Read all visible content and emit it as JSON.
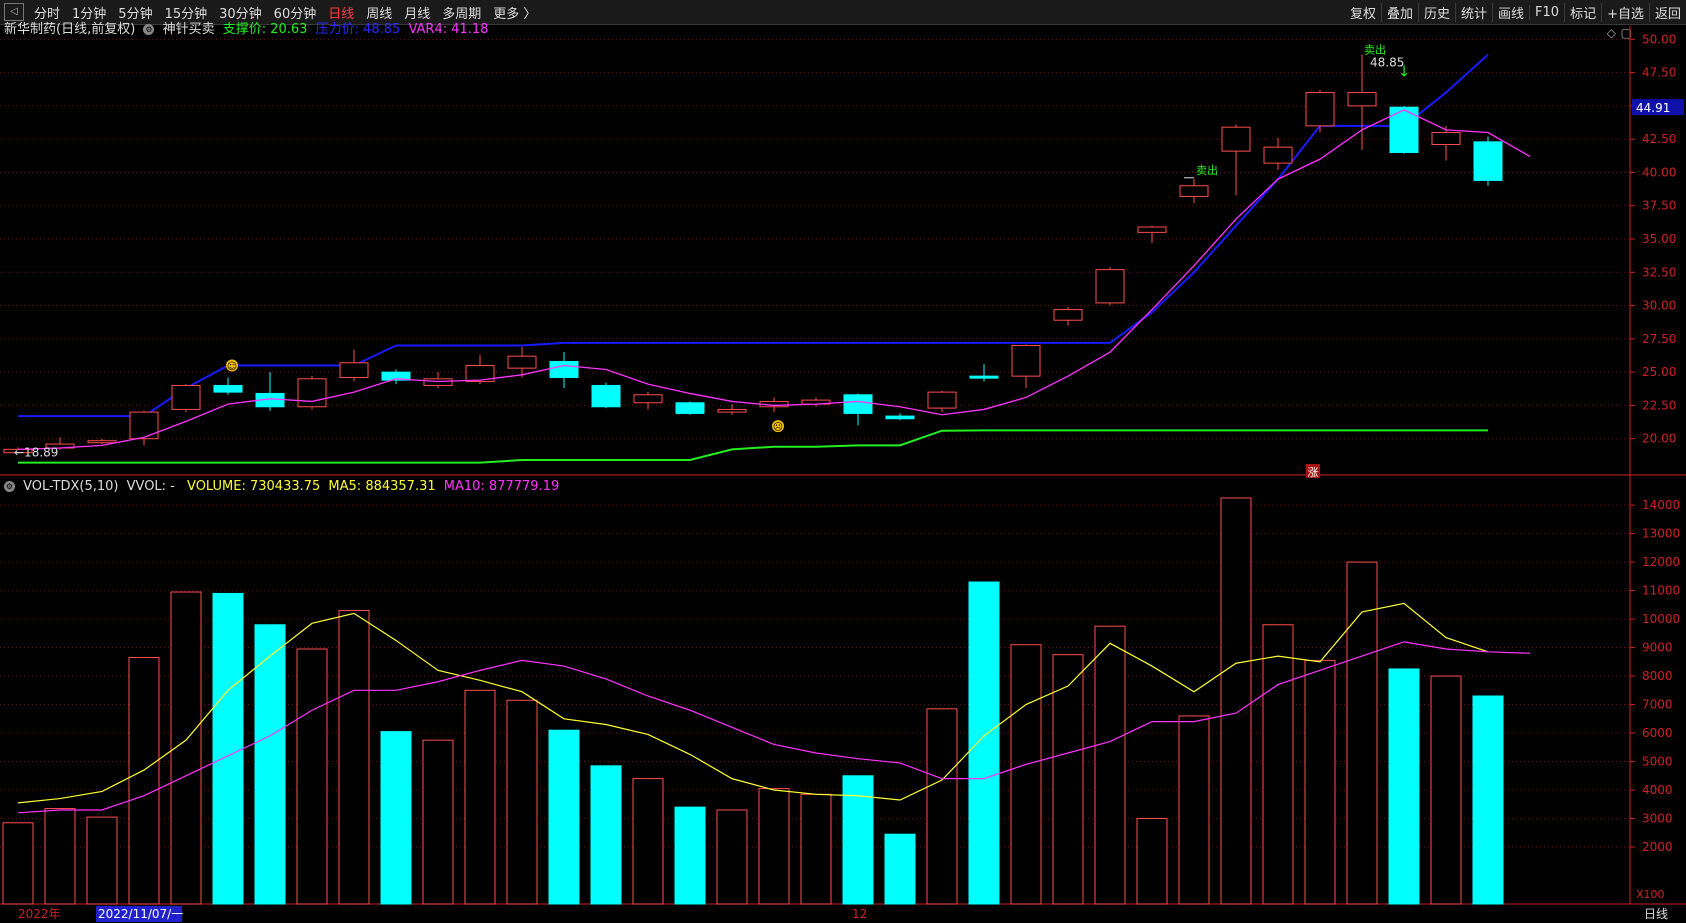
{
  "toolbar": {
    "collapse_label": "◁",
    "periods": [
      "分时",
      "1分钟",
      "5分钟",
      "15分钟",
      "30分钟",
      "60分钟",
      "日线",
      "周线",
      "月线",
      "多周期",
      "更多 〉"
    ],
    "active_period_index": 6,
    "tools": [
      "复权",
      "叠加",
      "历史",
      "统计",
      "画线",
      "F10",
      "标记",
      "+自选",
      "返回"
    ]
  },
  "main_info": {
    "stock_name": "新华制药(日线,前复权)",
    "indicator_name": "神针买卖",
    "support_label": "支撑价: 20.63",
    "pressure_label": "压力价: 48.85",
    "var4_label": "VAR4: 41.18"
  },
  "vol_info": {
    "name": "VOL-TDX(5,10)",
    "vvol": "VVOL: -",
    "volume_label": "VOLUME: 730433.75",
    "ma5_label": "MA5: 884357.31",
    "ma10_label": "MA10: 877779.19"
  },
  "annotations": {
    "low_label": "←18.89",
    "high_label": "48.85",
    "sell_label_1": "卖出",
    "sell_label_2": "卖出",
    "current_price": "44.91",
    "zhang_mark": "涨",
    "vol_unit": "X100",
    "bottom_right": "日线",
    "x_year": "2022年",
    "x_cursor_date": "2022/11/07/一",
    "x_month": "12"
  },
  "colors": {
    "up": "#ff4d4d",
    "down": "#00ffff",
    "ma": "#ff33ff",
    "ma5_vol": "#ffff33",
    "pressure": "#1a1aff",
    "support": "#22ee22",
    "axis": "#cc2222",
    "grid": "#661111"
  },
  "chart_data": [
    {
      "type": "candlestick",
      "price_axis": {
        "ylim": [
          17.5,
          51.0
        ],
        "ticks": [
          "20.00",
          "22.50",
          "25.00",
          "27.50",
          "30.00",
          "32.50",
          "35.00",
          "37.50",
          "40.00",
          "42.50",
          "45.00",
          "47.50",
          "50.00"
        ]
      },
      "candles": [
        {
          "open": 18.95,
          "close": 19.2,
          "high": 19.35,
          "low": 18.89
        },
        {
          "open": 19.3,
          "close": 19.6,
          "high": 20.1,
          "low": 19.15
        },
        {
          "open": 19.7,
          "close": 19.85,
          "high": 20.0,
          "low": 19.6
        },
        {
          "open": 20.0,
          "close": 22.0,
          "high": 22.1,
          "low": 19.5
        },
        {
          "open": 22.2,
          "close": 24.0,
          "high": 24.1,
          "low": 22.0
        },
        {
          "open": 24.0,
          "close": 23.5,
          "high": 24.6,
          "low": 23.3
        },
        {
          "open": 23.4,
          "close": 22.4,
          "high": 25.0,
          "low": 22.1
        },
        {
          "open": 22.4,
          "close": 24.5,
          "high": 24.7,
          "low": 22.2
        },
        {
          "open": 24.6,
          "close": 25.7,
          "high": 26.7,
          "low": 24.3
        },
        {
          "open": 25.0,
          "close": 24.4,
          "high": 25.2,
          "low": 24.1
        },
        {
          "open": 24.0,
          "close": 24.5,
          "high": 25.0,
          "low": 23.8
        },
        {
          "open": 24.3,
          "close": 25.5,
          "high": 26.3,
          "low": 24.1
        },
        {
          "open": 25.3,
          "close": 26.2,
          "high": 26.9,
          "low": 24.6
        },
        {
          "open": 25.8,
          "close": 24.6,
          "high": 26.5,
          "low": 23.8
        },
        {
          "open": 24.0,
          "close": 22.4,
          "high": 24.2,
          "low": 22.3
        },
        {
          "open": 22.7,
          "close": 23.3,
          "high": 23.5,
          "low": 22.2
        },
        {
          "open": 22.7,
          "close": 21.9,
          "high": 22.8,
          "low": 21.8
        },
        {
          "open": 22.0,
          "close": 22.2,
          "high": 22.6,
          "low": 21.8
        },
        {
          "open": 22.4,
          "close": 22.8,
          "high": 23.1,
          "low": 22.0
        },
        {
          "open": 22.6,
          "close": 22.9,
          "high": 23.1,
          "low": 22.4
        },
        {
          "open": 23.3,
          "close": 21.9,
          "high": 23.4,
          "low": 21.0
        },
        {
          "open": 21.7,
          "close": 21.5,
          "high": 21.9,
          "low": 21.4
        },
        {
          "open": 22.3,
          "close": 23.5,
          "high": 23.6,
          "low": 22.0
        },
        {
          "open": 24.7,
          "close": 24.6,
          "high": 25.6,
          "low": 24.3
        },
        {
          "open": 24.7,
          "close": 27.0,
          "high": 27.1,
          "low": 23.8
        },
        {
          "open": 28.9,
          "close": 29.7,
          "high": 29.9,
          "low": 28.5
        },
        {
          "open": 30.2,
          "close": 32.7,
          "high": 32.9,
          "low": 30.0
        },
        {
          "open": 35.5,
          "close": 35.9,
          "high": 36.0,
          "low": 34.7
        },
        {
          "open": 38.2,
          "close": 39.0,
          "high": 39.5,
          "low": 37.7
        },
        {
          "open": 41.6,
          "close": 43.4,
          "high": 43.6,
          "low": 38.3
        },
        {
          "open": 40.7,
          "close": 41.9,
          "high": 42.6,
          "low": 40.2
        },
        {
          "open": 43.5,
          "close": 46.0,
          "high": 46.2,
          "low": 43.0
        },
        {
          "open": 45.0,
          "close": 46.0,
          "high": 48.85,
          "low": 41.7
        },
        {
          "open": 44.9,
          "close": 41.5,
          "high": 45.0,
          "low": 41.4
        },
        {
          "open": 42.1,
          "close": 43.0,
          "high": 43.5,
          "low": 40.9
        },
        {
          "open": 42.3,
          "close": 39.4,
          "high": 42.7,
          "low": 39.0
        }
      ],
      "ma": [
        19.2,
        19.3,
        19.5,
        20.1,
        21.3,
        22.6,
        23.0,
        22.8,
        23.5,
        24.5,
        24.3,
        24.4,
        24.8,
        25.5,
        25.2,
        24.1,
        23.4,
        22.8,
        22.5,
        22.6,
        22.8,
        22.4,
        21.8,
        22.2,
        23.1,
        24.7,
        26.5,
        29.7,
        33.0,
        36.5,
        39.5,
        41.0,
        43.2,
        44.7,
        43.2,
        43.0,
        41.2
      ],
      "pressure": [
        21.7,
        21.7,
        21.7,
        21.7,
        23.8,
        25.5,
        25.5,
        25.5,
        25.5,
        27.0,
        27.0,
        27.0,
        27.0,
        27.2,
        27.2,
        27.2,
        27.2,
        27.2,
        27.2,
        27.2,
        27.2,
        27.2,
        27.2,
        27.2,
        27.2,
        27.2,
        27.2,
        29.5,
        32.5,
        36.0,
        39.5,
        43.5,
        43.5,
        43.5,
        46.0,
        48.85,
        48.85,
        48.85
      ],
      "support": [
        18.2,
        18.2,
        18.2,
        18.2,
        18.2,
        18.2,
        18.2,
        18.2,
        18.2,
        18.2,
        18.2,
        18.2,
        18.4,
        18.4,
        18.4,
        18.4,
        18.4,
        19.2,
        19.4,
        19.4,
        19.5,
        19.5,
        20.6,
        20.63,
        20.63,
        20.63,
        20.63,
        20.63,
        20.63,
        20.63,
        20.63,
        20.63,
        20.63,
        20.63,
        20.63,
        20.63
      ],
      "smile_index": 5,
      "frown_index": 18,
      "sell_indices": [
        28,
        32
      ],
      "down_arrow_index": 33
    },
    {
      "type": "bar",
      "unit": "X100",
      "ylim": [
        0,
        14600
      ],
      "ticks": [
        "2000",
        "3000",
        "4000",
        "5000",
        "6000",
        "7000",
        "8000",
        "9000",
        "10000",
        "11000",
        "12000",
        "13000",
        "14000"
      ],
      "values": [
        2850,
        3350,
        3050,
        8650,
        10950,
        10900,
        9800,
        8950,
        10300,
        6050,
        5750,
        7500,
        7150,
        6100,
        4850,
        4400,
        3400,
        3300,
        4050,
        3850,
        4500,
        2450,
        6850,
        11300,
        9100,
        8750,
        9750,
        3000,
        6600,
        14250,
        9800,
        8550,
        12000,
        8250,
        8000,
        7300
      ],
      "ma5": [
        3550,
        3700,
        3950,
        4700,
        5750,
        7500,
        8700,
        9850,
        10200,
        9250,
        8200,
        7850,
        7450,
        6500,
        6300,
        5950,
        5250,
        4400,
        4000,
        3850,
        3800,
        3650,
        4350,
        5900,
        7000,
        7650,
        9150,
        8350,
        7450,
        8450,
        8700,
        8500,
        10250,
        10550,
        9350,
        8850
      ],
      "ma10": [
        3200,
        3300,
        3300,
        3800,
        4500,
        5200,
        5900,
        6800,
        7500,
        7500,
        7800,
        8200,
        8550,
        8350,
        7900,
        7300,
        6800,
        6200,
        5600,
        5300,
        5100,
        4950,
        4400,
        4400,
        4900,
        5300,
        5700,
        6400,
        6400,
        6700,
        7700,
        8200,
        8700,
        9200,
        8950,
        8850,
        8800
      ],
      "color_up": [
        true,
        true,
        true,
        true,
        true,
        false,
        false,
        true,
        true,
        false,
        true,
        true,
        true,
        false,
        false,
        true,
        false,
        true,
        true,
        true,
        false,
        false,
        true,
        false,
        true,
        true,
        true,
        true,
        true,
        true,
        true,
        true,
        true,
        false,
        true,
        false
      ]
    }
  ]
}
